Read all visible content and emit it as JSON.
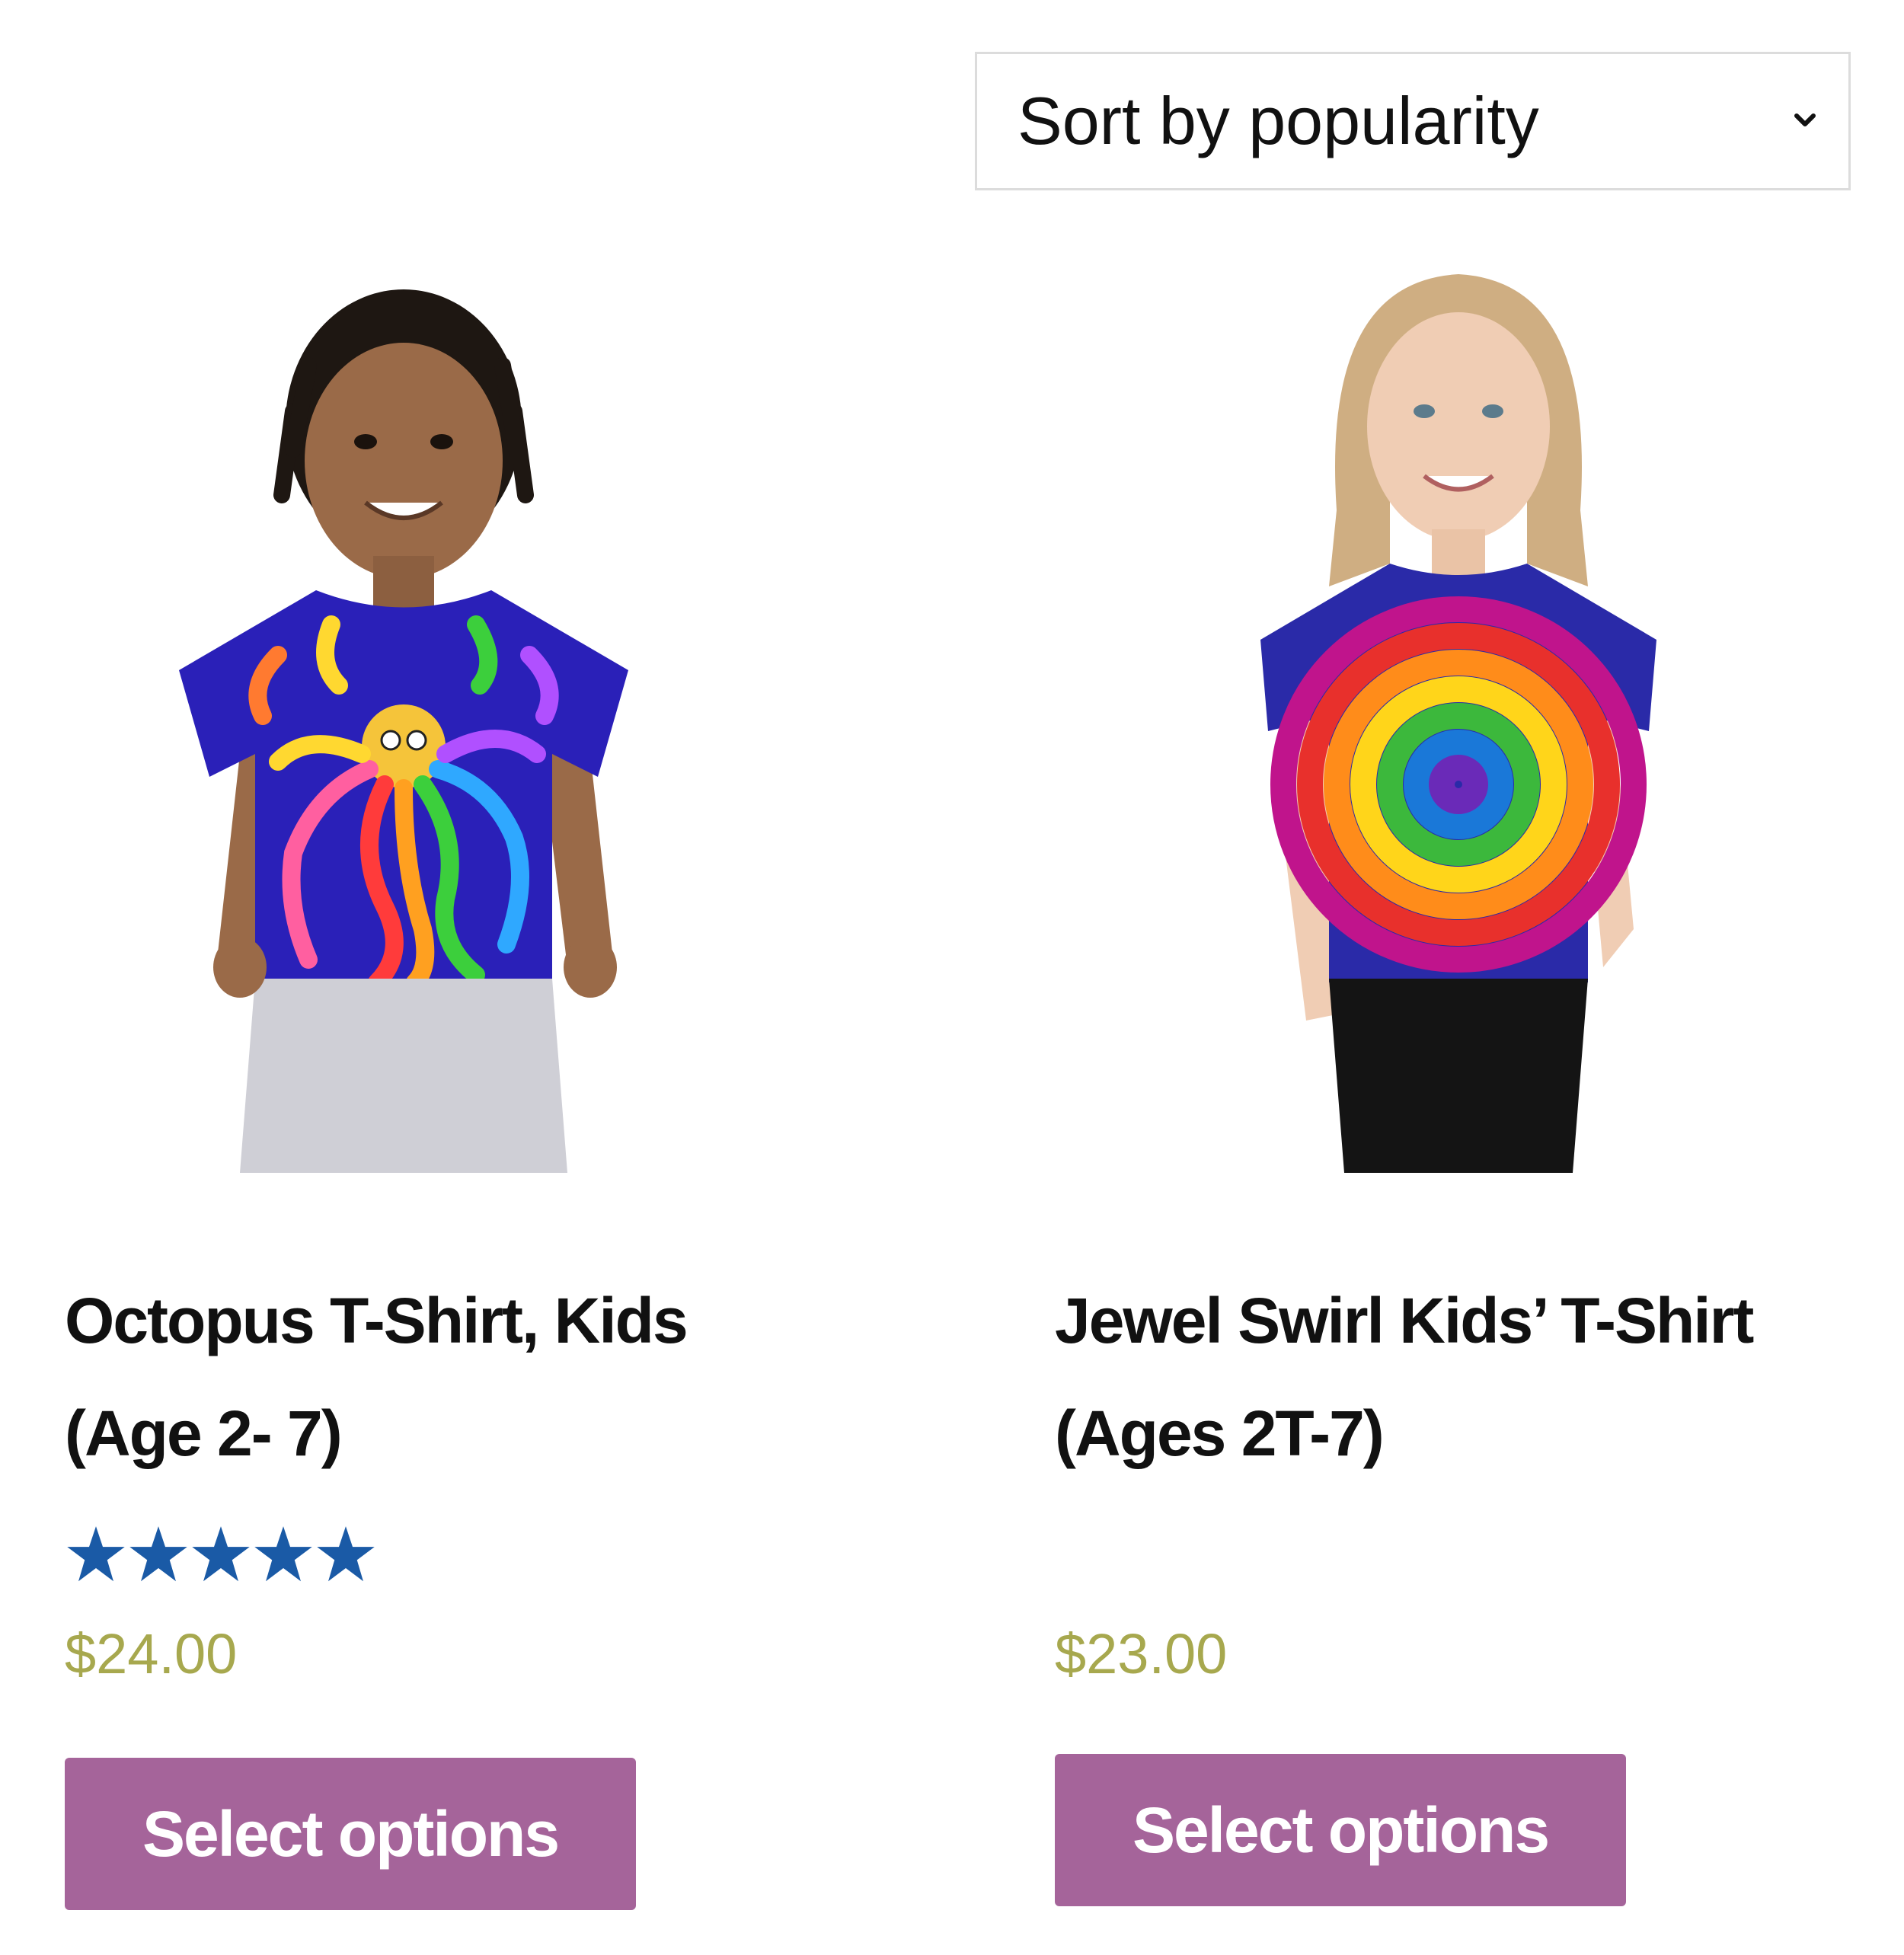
{
  "sort": {
    "selected": "Sort by popularity",
    "icon": "chevron-down-icon"
  },
  "products": [
    {
      "image": "kid-in-octopus-tshirt-photo",
      "title_lines": [
        "Octopus T-Shirt, Kids",
        "(Age 2- 7)"
      ],
      "rating": 5,
      "rating_max": 5,
      "star_color": "#1a5aa6",
      "price": "$24.00",
      "button_label": "Select options"
    },
    {
      "image": "kid-in-jewel-swirl-tshirt-photo",
      "title_lines": [
        "Jewel Swirl Kids’ T-Shirt",
        "(Ages 2T-7)"
      ],
      "price": "$23.00",
      "button_label": "Select options"
    }
  ],
  "colors": {
    "button": "#a5649a",
    "price": "#a7a84e",
    "select_border": "#dcdcdc"
  }
}
